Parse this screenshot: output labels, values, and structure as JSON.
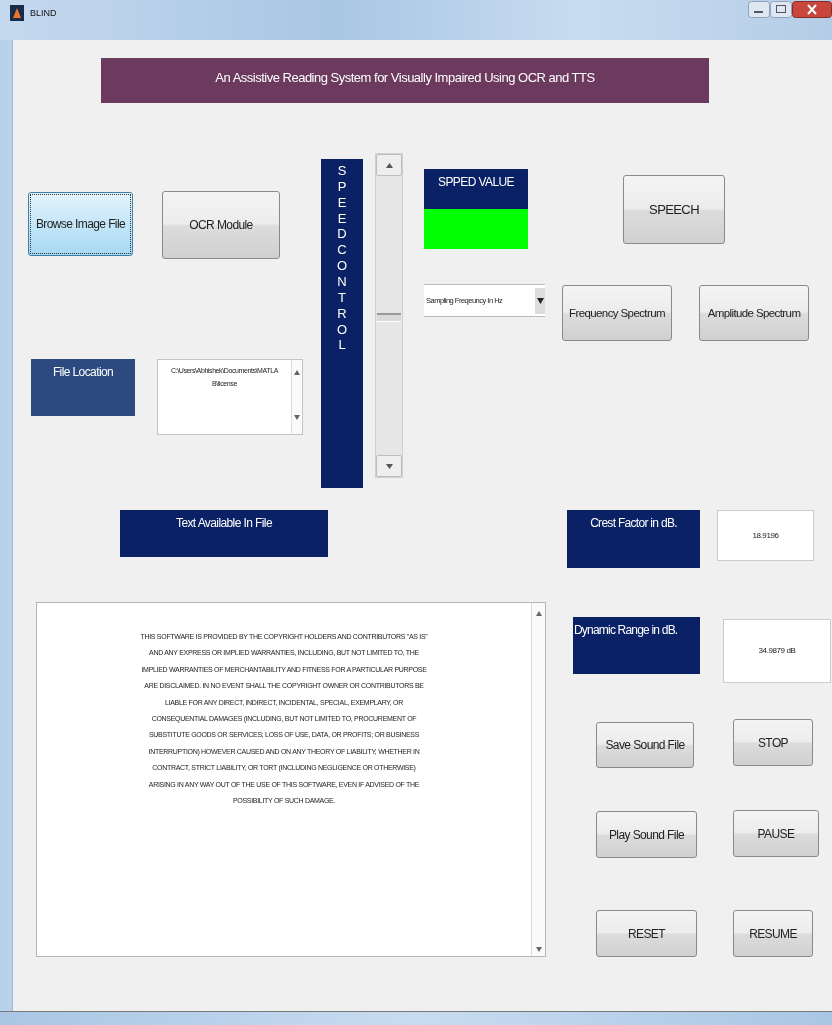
{
  "window": {
    "title": "BLIND"
  },
  "heading": "An Assistive Reading System for Visually Impaired Using OCR and TTS",
  "buttons_top": [
    {
      "label": "Browse Image File",
      "focused": true
    },
    {
      "label": "OCR Module",
      "focused": false
    }
  ],
  "speed_control": {
    "label": "SPEEDCONTROL",
    "level": 0.5
  },
  "speed_value": {
    "label": "SPPED VALUE",
    "color": "#00ff00"
  },
  "sampling_dropdown": {
    "value": "Sampling Freqeuncy In Hz"
  },
  "speech_button": "SPEECH",
  "spectrum_buttons": [
    "Frequency Spectrum",
    "Amplitude Spectrum"
  ],
  "file_location": {
    "label": "File Location",
    "path_lines": [
      "C:\\Users\\Abhishek\\Documents\\MATLA",
      "B\\license"
    ]
  },
  "text_label": "Text Available In File",
  "crest_factor": {
    "label": "Crest Factor in dB.",
    "value": "18.9196"
  },
  "dynamic_range": {
    "label": "Dynamic Range in dB.",
    "value": "34.9879 dB"
  },
  "file_text": [
    "THIS SOFTWARE IS PROVIDED BY THE COPYRIGHT HOLDERS AND CONTRIBUTORS \"AS IS\"",
    "AND ANY EXPRESS OR IMPLIED WARRANTIES, INCLUDING, BUT NOT LIMITED TO, THE",
    "IMPLIED WARRANTIES OF MERCHANTABILITY AND FITNESS FOR A PARTICULAR PURPOSE",
    "ARE DISCLAIMED. IN NO EVENT SHALL THE COPYRIGHT OWNER OR CONTRIBUTORS BE",
    "LIABLE FOR ANY DIRECT, INDIRECT, INCIDENTAL, SPECIAL, EXEMPLARY, OR",
    "CONSEQUENTIAL DAMAGES (INCLUDING, BUT NOT LIMITED TO, PROCUREMENT OF",
    "SUBSTITUTE GOODS OR SERVICES; LOSS OF USE, DATA, OR PROFITS; OR BUSINESS",
    "INTERRUPTION) HOWEVER CAUSED AND ON ANY THEORY OF LIABILITY, WHETHER IN",
    "CONTRACT, STRICT LIABILITY, OR TORT (INCLUDING NEGLIGENCE OR OTHERWISE)",
    "ARISING IN ANY WAY OUT OF THE USE OF THIS SOFTWARE, EVEN IF ADVISED OF THE",
    "POSSIBILITY OF SUCH DAMAGE."
  ],
  "sound_buttons": [
    "Save Sound File",
    "STOP",
    "Play Sound File",
    "PAUSE",
    "RESET",
    "RESUME"
  ]
}
